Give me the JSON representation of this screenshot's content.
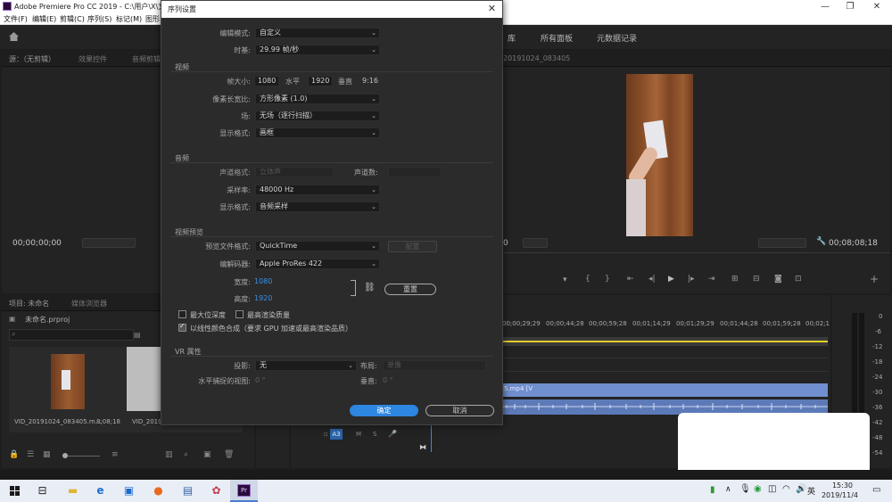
{
  "window": {
    "title": "Adobe Premiere Pro CC 2019 - C:\\用户\\X\\文",
    "menus": [
      "文件(F)",
      "编辑(E)",
      "剪辑(C)",
      "序列(S)",
      "标记(M)",
      "图形"
    ]
  },
  "workspace": {
    "tabs": [
      "库",
      "所有面板",
      "元数据记录"
    ]
  },
  "source_panel": {
    "tabs": [
      "源：（无剪辑）",
      "效果控件",
      "音频剪辑"
    ],
    "timecode": "00;00;00;00"
  },
  "program_panel": {
    "tab": "20191024_083405",
    "timecode_left": "0",
    "timecode_right": "00;08;08;18"
  },
  "project_panel": {
    "tabs": [
      "项目: 未命名",
      "媒体浏览器"
    ],
    "project_file": "未命名.prproj",
    "clip_name": "VID_20191024_083405.m...",
    "clip_duration": "8;08;18",
    "clip2_name": "VID_2019"
  },
  "timeline": {
    "ruler": [
      "00;00;29;29",
      "00;00;44;28",
      "00;00;59;28",
      "00;01;14;29",
      "00;01;29;29",
      "00;01;44;28",
      "00;01;59;28",
      "00;02;1"
    ],
    "video_clip_label": "5.mp4 [V",
    "track_label": "A3",
    "meter_scale": [
      "0",
      "-6",
      "-12",
      "-18",
      "-24",
      "-30",
      "-36",
      "-42",
      "-48",
      "-54"
    ]
  },
  "dialog": {
    "title": "序列设置",
    "editing_mode_label": "编辑模式:",
    "editing_mode": "自定义",
    "timebase_label": "时基:",
    "timebase": "29.99  帧/秒",
    "video_section": "视频",
    "frame_size_label": "帧大小:",
    "frame_width": "1080",
    "horizontal_label": "水平",
    "frame_height": "1920",
    "vertical_label": "垂直",
    "aspect": "9:16",
    "pixel_aspect_label": "像素长宽比:",
    "pixel_aspect": "方形像素 (1.0)",
    "fields_label": "场:",
    "fields": "无场（逐行扫描）",
    "display_format_label": "显示格式:",
    "display_format": "画框",
    "audio_section": "音频",
    "channel_format_label": "声道格式:",
    "channel_format": "立体声",
    "channels_label": "声道数:",
    "sample_rate_label": "采样率:",
    "sample_rate": "48000 Hz",
    "audio_display_label": "显示格式:",
    "audio_display": "音频采样",
    "preview_section": "视频预览",
    "preview_format_label": "预览文件格式:",
    "preview_format": "QuickTime",
    "configure_btn": "配置",
    "codec_label": "编解码器:",
    "codec": "Apple ProRes 422",
    "width_label": "宽度:",
    "width_value": "1080",
    "height_label": "高度:",
    "height_value": "1920",
    "reset_btn": "重置",
    "max_depth": "最大位深度",
    "max_quality": "最高渲染质量",
    "linear_color": "以线性颜色合成（要求 GPU 加速或最高渲染品质）",
    "vr_section": "VR 属性",
    "projection_label": "投影:",
    "projection": "无",
    "layout_label": "布局:",
    "layout": "单像",
    "hfov_label": "水平捕捉的视图:",
    "hfov": "0 °",
    "vfov_label": "垂直:",
    "vfov": "0 °",
    "ok_btn": "确定",
    "cancel_btn": "取消"
  },
  "taskbar": {
    "time": "15:30",
    "date": "2019/11/4",
    "ime": "英"
  }
}
